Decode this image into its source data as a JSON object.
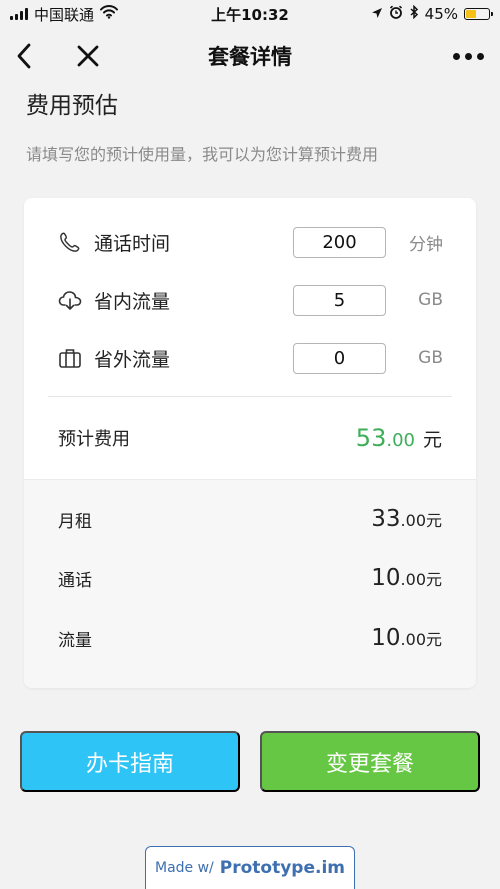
{
  "status_bar": {
    "carrier": "中国联通",
    "time": "上午10:32",
    "battery": "45%",
    "battery_level": 0.45,
    "icons": [
      "signal-icon",
      "wifi-icon",
      "location-icon",
      "alarm-icon",
      "bluetooth-icon",
      "battery-icon"
    ]
  },
  "nav": {
    "title": "套餐详情",
    "icons": [
      "back-icon",
      "close-icon",
      "more-icon"
    ]
  },
  "section": {
    "title": "费用预估",
    "description": "请填写您的预计使用量，我可以为您计算预计费用"
  },
  "usage_inputs": [
    {
      "icon": "phone-icon",
      "label": "通话时间",
      "value": "200",
      "unit": "分钟"
    },
    {
      "icon": "cloud-download-icon",
      "label": "省内流量",
      "value": "5",
      "unit": "GB"
    },
    {
      "icon": "luggage-icon",
      "label": "省外流量",
      "value": "0",
      "unit": "GB"
    }
  ],
  "estimate": {
    "label": "预计费用",
    "integer": "53",
    "decimal": ".00",
    "unit": "元",
    "color": "#3fae5a"
  },
  "breakdown": [
    {
      "label": "月租",
      "integer": "33",
      "decimal": ".00元"
    },
    {
      "label": "通话",
      "integer": "10",
      "decimal": ".00元"
    },
    {
      "label": "流量",
      "integer": "10",
      "decimal": ".00元"
    }
  ],
  "buttons": {
    "guide": {
      "label": "办卡指南",
      "color": "#2ec4f5"
    },
    "change": {
      "label": "变更套餐",
      "color": "#66c744"
    }
  },
  "watermark": {
    "prefix": "Made w/",
    "brand": "Prototype.im"
  }
}
